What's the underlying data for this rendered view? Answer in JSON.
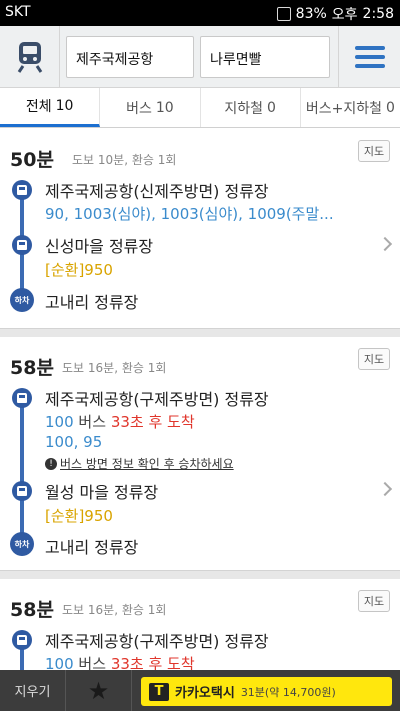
{
  "status": {
    "carrier": "SKT",
    "battery": "83%",
    "ampm": "오후",
    "time": "2:58"
  },
  "search": {
    "from": "제주국제공항",
    "to": "나루면빨"
  },
  "tabs": [
    {
      "label": "전체",
      "count": "10"
    },
    {
      "label": "버스",
      "count": "10"
    },
    {
      "label": "지하철",
      "count": "0"
    },
    {
      "label": "버스+지하철",
      "count": "0"
    }
  ],
  "map_label": "지도",
  "alight_label": "하차",
  "routes": [
    {
      "time": "50분",
      "summary": "도보 10분, 환승 1회",
      "stop1": "제주국제공항(신제주방면) 정류장",
      "buses1": "90, 1003(심야), 1003(심야), 1009(주말...",
      "stop2": "신성마을 정류장",
      "buses2": "[순환]950",
      "stop3": "고내리 정류장"
    },
    {
      "time": "58분",
      "summary": "도보 16분, 환승 1회",
      "stop1": "제주국제공항(구제주방면) 정류장",
      "arrive_bus": "100",
      "arrive_label": "버스",
      "arrive_time": "33초 후 도착",
      "buses1": "100, 95",
      "notice": "버스 방면 정보 확인 후 승차하세요",
      "stop2": "월성 마을 정류장",
      "buses2": "[순환]950",
      "stop3": "고내리 정류장"
    },
    {
      "time": "58분",
      "summary": "도보 16분, 환승 1회",
      "stop1": "제주국제공항(구제주방면) 정류장",
      "arrive_bus": "100",
      "arrive_label": "버스",
      "arrive_time": "33초 후 도착"
    }
  ],
  "bottom": {
    "clear": "지우기",
    "taxi_name": "카카오택시",
    "taxi_info": "31분(약 14,700원)",
    "taxi_logo": "T"
  },
  "colors": {
    "accent": "#1c6fd0",
    "route": "#2f5aa2",
    "bus_number": "#3a8bcc",
    "circular": "#d9a400",
    "arrival": "#e0362c",
    "taxi": "#ffe70d"
  }
}
